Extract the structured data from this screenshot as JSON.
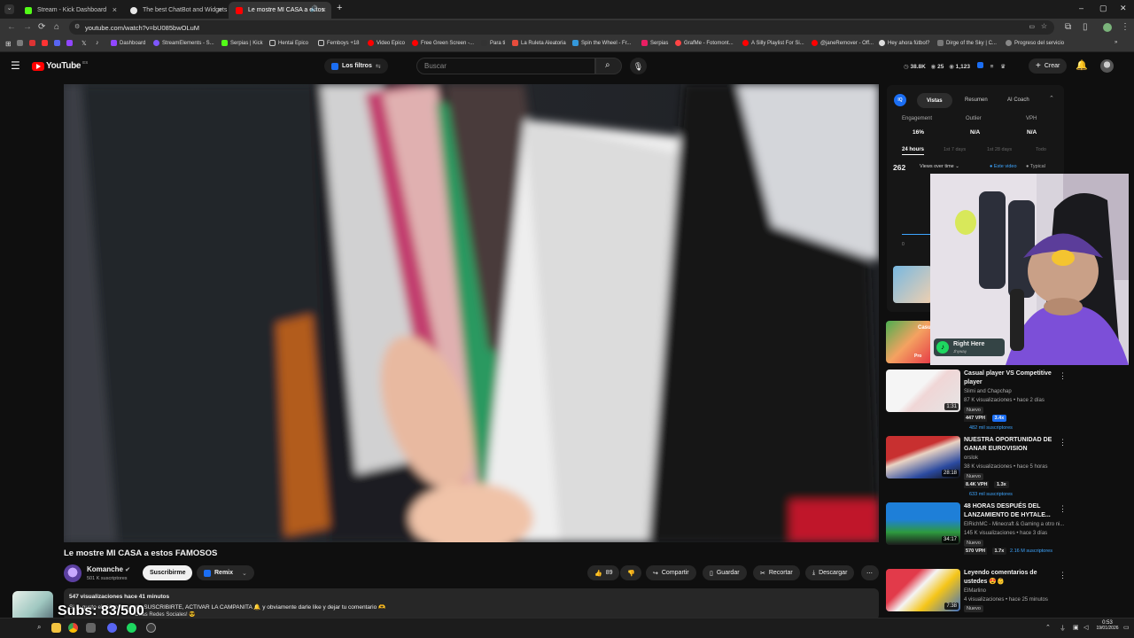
{
  "browser": {
    "tabs": [
      {
        "title": "Stream - Kick Dashboard",
        "color": "#53fc18"
      },
      {
        "title": "The best ChatBot and Widgets",
        "color": "#e8e8e8"
      },
      {
        "title": "Le mostre MI CASA a estos",
        "color": "#ff0000"
      }
    ],
    "new_tab": "+",
    "url": "youtube.com/watch?v=bU085bwOLuM",
    "bookmarks": [
      "Dashboard",
      "StreamElements - S...",
      "Serpias | Kick",
      "Hentai Epico",
      "Femboys +18",
      "Video Epico",
      "Free Green Screen -...",
      "Para ti",
      "La Ruleta Aleatoria",
      "Spin the Wheel - Fr...",
      "Serpias",
      "GrafMe - Fotomont...",
      "A Silly Playlist For Si...",
      "@janeRemover - Off...",
      "Hey ahora fútbol?",
      "Dirge of the Sky | C...",
      "Progreso del servicio"
    ]
  },
  "youtube": {
    "logo": "YouTube",
    "country": "ES",
    "filters_label": "Los filtros",
    "search_placeholder": "Buscar",
    "header_stats": {
      "views": "38.8K",
      "likes": "25",
      "subs": "1,123"
    },
    "create_label": "Crear"
  },
  "video": {
    "title": "Le mostre MI CASA a estos FAMOSOS",
    "channel": "Komanche",
    "subscribers": "501 K suscriptores",
    "subscribe_label": "Suscribirme",
    "remix_label": "Remix",
    "likes": "89",
    "share_label": "Compartir",
    "save_label": "Guardar",
    "clip_label": "Recortar",
    "download_label": "Descargar",
    "desc_meta": "547 visualizaciones  hace 41 minutos",
    "desc_line1": "Si te gusto el video recuerda SUSCRIBIRTE, ACTIVAR LA CAMPANITA 🔔 y obviamente darle like y dejar tu comentario 🫶",
    "desc_line2": "Otras Redes Sociales! 😎"
  },
  "vidiq": {
    "tabs": [
      "Vistas",
      "Resumen",
      "AI Coach"
    ],
    "metrics": [
      {
        "label": "Engagement",
        "value": "16%"
      },
      {
        "label": "Outlier",
        "value": "N/A"
      },
      {
        "label": "VPH",
        "value": "N/A"
      }
    ],
    "ranges": [
      "24 hours",
      "1st 7 days",
      "1st 28 days",
      "Todo"
    ],
    "views": "262",
    "views_mode": "Views over time",
    "legend_this": "Este video",
    "legend_typical": "Typical",
    "axis_zero": "0"
  },
  "overlay": {
    "song": "Right Here",
    "artist": "Jhyway",
    "subs_goal": "Subs: 83/500"
  },
  "recommendations": [
    {
      "title": "Casual player VS Competitive player",
      "channel": "Slimi and Chapchap",
      "meta": "87 K visualizaciones • hace 2 días",
      "badge": "Nuevo",
      "vph": "447 VPH",
      "mult": "3.4x",
      "subs": "482 mil suscriptores",
      "duration": "1:31"
    },
    {
      "title": "NUESTRA OPORTUNIDAD DE GANAR EUROVISION",
      "channel": "orslok",
      "meta": "38 K visualizaciones • hace 5 horas",
      "badge": "Nuevo",
      "vph": "8.4K VPH",
      "mult": "1.3x",
      "subs": "633 mil suscriptores",
      "duration": "28:18"
    },
    {
      "title": "48 HORAS DESPUÉS DEL LANZAMIENTO DE HYTALE...",
      "channel": "ElRichMC - Minecraft & Gaming a otro ni...",
      "meta": "145 K visualizaciones • hace 3 días",
      "badge": "Nuevo",
      "vph": "570 VPH",
      "mult": "1.7x",
      "subs": "2.16 M suscriptores",
      "duration": "34:17"
    },
    {
      "title": "Leyendo comentarios de ustedes 😍👶",
      "channel": "ElMarlino",
      "meta": "4 visualizaciones • hace 25 minutos",
      "badge": "Nuevo",
      "vph": "",
      "mult": "",
      "subs": "",
      "duration": "7:38"
    }
  ],
  "side_partial": [
    {
      "text": "Casu",
      "sub": "Pro"
    }
  ],
  "taskbar": {
    "time": "0:53",
    "date": "19/01/2026"
  },
  "colors": {
    "accent_red": "#ff0000",
    "link_blue": "#3ea6ff",
    "vidiq_blue": "#1b6ef3"
  }
}
